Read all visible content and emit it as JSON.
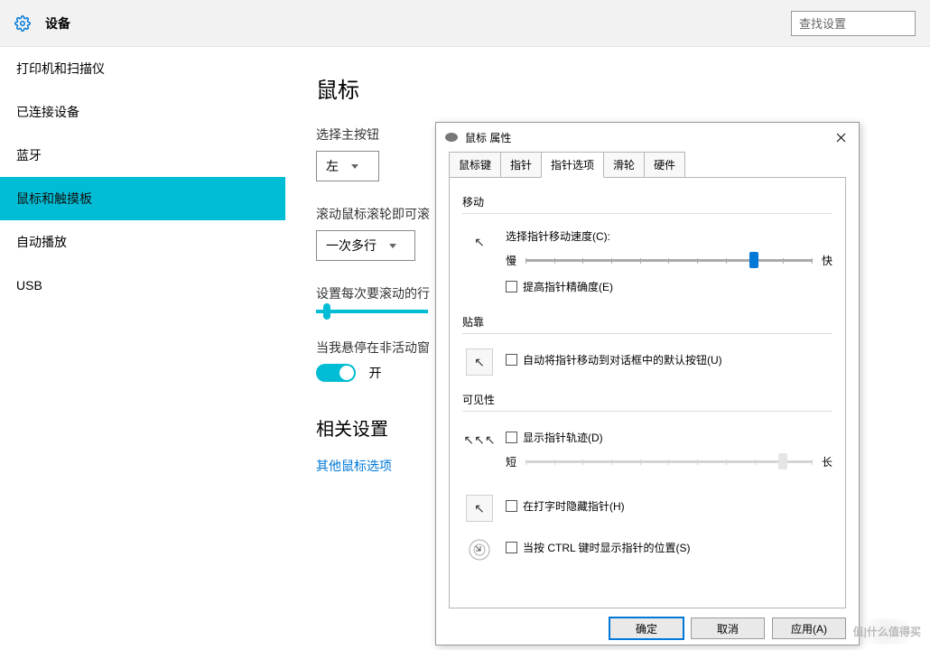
{
  "header": {
    "title": "设备",
    "search_placeholder": "查找设置"
  },
  "sidebar": {
    "items": [
      {
        "label": "打印机和扫描仪"
      },
      {
        "label": "已连接设备"
      },
      {
        "label": "蓝牙"
      },
      {
        "label": "鼠标和触摸板"
      },
      {
        "label": "自动播放"
      },
      {
        "label": "USB"
      }
    ]
  },
  "main": {
    "heading": "鼠标",
    "primary_button_label": "选择主按钮",
    "primary_button_value": "左",
    "scroll_behavior_label": "滚动鼠标滚轮即可滚",
    "scroll_behavior_value": "一次多行",
    "lines_label": "设置每次要滚动的行",
    "hover_label": "当我悬停在非活动窗",
    "hover_toggle_text": "开",
    "related_heading": "相关设置",
    "related_link": "其他鼠标选项"
  },
  "dialog": {
    "title": "鼠标 属性",
    "tabs": [
      "鼠标键",
      "指针",
      "指针选项",
      "滑轮",
      "硬件"
    ],
    "active_tab": 2,
    "groups": {
      "motion": {
        "label": "移动",
        "speed_label": "选择指针移动速度(C):",
        "slow": "慢",
        "fast": "快",
        "speed_pos": 0.78,
        "enhance_precision": "提高指针精确度(E)"
      },
      "snap": {
        "label": "贴靠",
        "snap_default": "自动将指针移动到对话框中的默认按钮(U)"
      },
      "visibility": {
        "label": "可见性",
        "trails": "显示指针轨迹(D)",
        "short": "短",
        "long": "长",
        "trail_pos": 0.88,
        "hide_typing": "在打字时隐藏指针(H)",
        "ctrl_locate": "当按 CTRL 键时显示指针的位置(S)"
      }
    },
    "buttons": {
      "ok": "确定",
      "cancel": "取消",
      "apply": "应用(A)"
    }
  },
  "watermark": "值|什么值得买"
}
